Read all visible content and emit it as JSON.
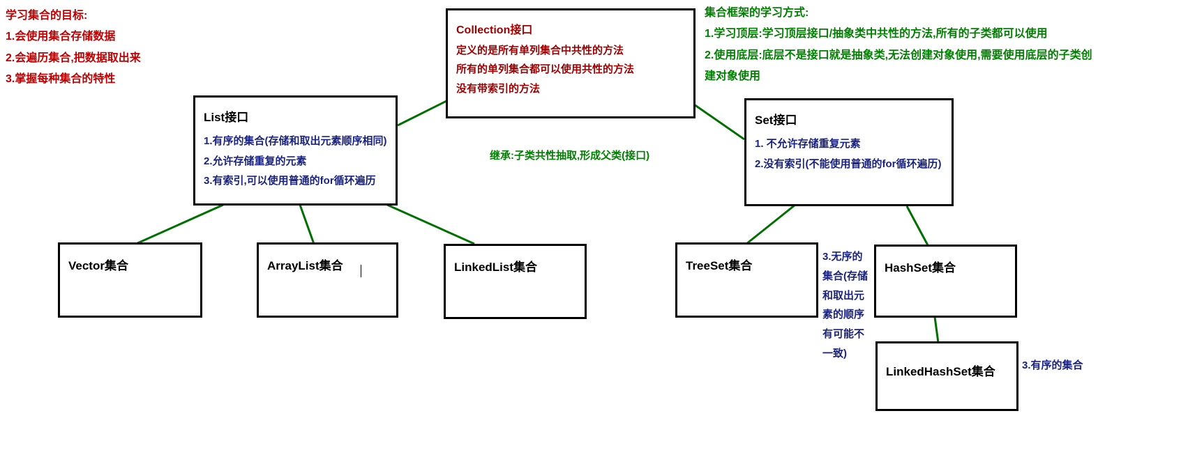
{
  "goals": {
    "title": "学习集合的目标:",
    "items": [
      "1.会使用集合存储数据",
      "2.会遍历集合,把数据取出来",
      "3.掌握每种集合的特性"
    ]
  },
  "study_method": {
    "title": "集合框架的学习方式:",
    "items": [
      "1.学习顶层:学习顶层接口/抽象类中共性的方法,所有的子类都可以使用",
      "2.使用底层:底层不是接口就是抽象类,无法创建对象使用,需要使用底层的子类创建对象使用"
    ]
  },
  "collection": {
    "title": "Collection接口",
    "lines": [
      "定义的是所有单列集合中共性的方法",
      "所有的单列集合都可以使用共性的方法",
      "没有带索引的方法"
    ]
  },
  "list": {
    "title": "List接口",
    "lines": [
      "1.有序的集合(存储和取出元素顺序相同)",
      "2.允许存储重复的元素",
      "3.有索引,可以使用普通的for循环遍历"
    ]
  },
  "set": {
    "title": "Set接口",
    "lines": [
      "1. 不允许存储重复元素",
      "2.没有索引(不能使用普通的for循环遍历)"
    ]
  },
  "leaves": {
    "vector": "Vector集合",
    "arraylist": "ArrayList集合",
    "linkedlist": "LinkedList集合",
    "treeset": "TreeSet集合",
    "hashset": "HashSet集合",
    "linkedhashset": "LinkedHashSet集合"
  },
  "annotations": {
    "inherit": "继承:子类共性抽取,形成父类(接口)",
    "hashset_note": "3.无序的集合(存储和取出元素的顺序有可能不一致)",
    "linkedhashset_note": "3.有序的集合"
  }
}
